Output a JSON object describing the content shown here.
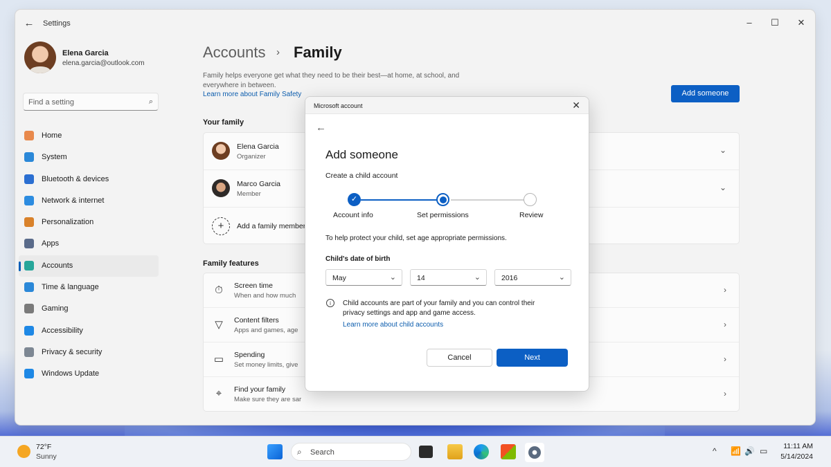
{
  "window": {
    "title": "Settings",
    "back_icon": "←",
    "minimize": "–",
    "maximize": "☐",
    "close": "✕"
  },
  "profile": {
    "name": "Elena Garcia",
    "email": "elena.garcia@outlook.com"
  },
  "search": {
    "placeholder": "Find a setting",
    "icon": "⌕"
  },
  "sidebar": {
    "items": [
      {
        "label": "Home",
        "icon": "home-icon",
        "color": "#e8894c",
        "active": false
      },
      {
        "label": "System",
        "icon": "system-icon",
        "color": "#2b88d8",
        "active": false
      },
      {
        "label": "Bluetooth & devices",
        "icon": "bluetooth-icon",
        "color": "#2b6fd1",
        "active": false
      },
      {
        "label": "Network & internet",
        "icon": "wifi-icon",
        "color": "#2d8ce0",
        "active": false
      },
      {
        "label": "Personalization",
        "icon": "brush-icon",
        "color": "#d9822b",
        "active": false
      },
      {
        "label": "Apps",
        "icon": "apps-icon",
        "color": "#5a6b8a",
        "active": false
      },
      {
        "label": "Accounts",
        "icon": "accounts-icon",
        "color": "#26a69a",
        "active": true
      },
      {
        "label": "Time & language",
        "icon": "globe-icon",
        "color": "#2b88d8",
        "active": false
      },
      {
        "label": "Gaming",
        "icon": "gamepad-icon",
        "color": "#7a7a7a",
        "active": false
      },
      {
        "label": "Accessibility",
        "icon": "accessibility-icon",
        "color": "#1e88e5",
        "active": false
      },
      {
        "label": "Privacy & security",
        "icon": "shield-icon",
        "color": "#7d8793",
        "active": false
      },
      {
        "label": "Windows Update",
        "icon": "update-icon",
        "color": "#1e88e5",
        "active": false
      }
    ]
  },
  "main": {
    "breadcrumb_parent": "Accounts",
    "breadcrumb_sep": "›",
    "breadcrumb_current": "Family",
    "description": "Family helps everyone get what they need to be their best—at home, at school, and everywhere in between.",
    "learn_more": "Learn more about Family Safety",
    "add_button": "Add someone",
    "your_family_header": "Your family",
    "members": [
      {
        "name": "Elena Garcia",
        "role": "Organizer"
      },
      {
        "name": "Marco Garcia",
        "role": "Member"
      }
    ],
    "add_member": "Add a family member",
    "features_header": "Family features",
    "features": [
      {
        "title": "Screen time",
        "subtitle": "When and how much",
        "icon": "screen-time-icon"
      },
      {
        "title": "Content filters",
        "subtitle": "Apps and games, age",
        "icon": "filter-icon"
      },
      {
        "title": "Spending",
        "subtitle": "Set money limits, give",
        "icon": "card-icon"
      },
      {
        "title": "Find your family",
        "subtitle": "Make sure they are sar",
        "icon": "location-icon"
      }
    ]
  },
  "dialog": {
    "title": "Microsoft account",
    "heading": "Add someone",
    "subheading": "Create a child account",
    "steps": [
      {
        "label": "Account info",
        "state": "complete"
      },
      {
        "label": "Set permissions",
        "state": "current"
      },
      {
        "label": "Review",
        "state": "pending"
      }
    ],
    "help_text": "To help protect your child, set age appropriate permissions.",
    "dob_label": "Child's date of birth",
    "dob_month": "May",
    "dob_day": "14",
    "dob_year": "2016",
    "info_text": "Child accounts are part of your family and you can control their privacy settings and app and game access.",
    "info_link": "Learn more about child accounts",
    "cancel": "Cancel",
    "next": "Next",
    "accent": "#0c5fc4"
  },
  "taskbar": {
    "temperature": "72°F",
    "condition": "Sunny",
    "search_placeholder": "Search",
    "time": "11:11 AM",
    "date": "5/14/2024",
    "tray": [
      "^",
      "wifi-icon",
      "volume-icon",
      "battery-icon"
    ]
  }
}
